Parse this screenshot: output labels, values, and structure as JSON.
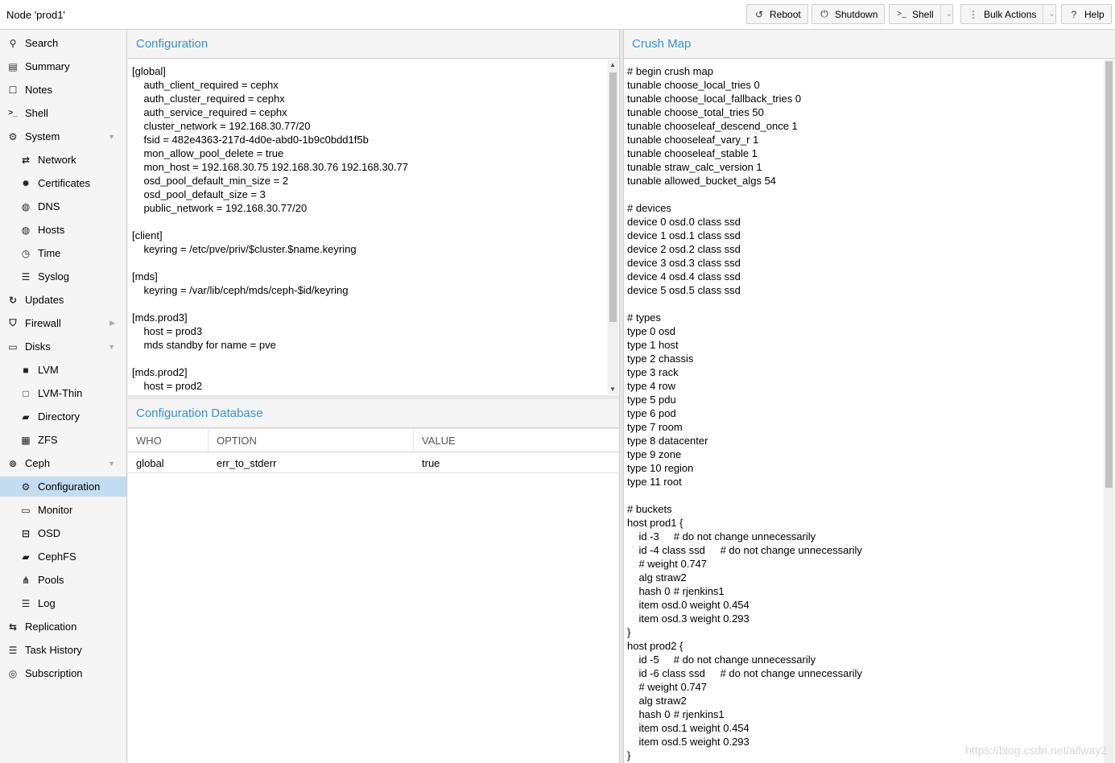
{
  "header": {
    "title": "Node 'prod1'",
    "buttons": {
      "reboot": "Reboot",
      "shutdown": "Shutdown",
      "shell": "Shell",
      "bulk_actions": "Bulk Actions",
      "help": "Help"
    }
  },
  "sidebar": {
    "items": [
      {
        "label": "Search",
        "icon": "search-icon"
      },
      {
        "label": "Summary",
        "icon": "book-icon"
      },
      {
        "label": "Notes",
        "icon": "note-icon"
      },
      {
        "label": "Shell",
        "icon": "terminal-icon"
      },
      {
        "label": "System",
        "icon": "gears-icon"
      },
      {
        "label": "Network",
        "icon": "exchange-icon"
      },
      {
        "label": "Certificates",
        "icon": "certificate-icon"
      },
      {
        "label": "DNS",
        "icon": "globe-icon"
      },
      {
        "label": "Hosts",
        "icon": "globe-icon"
      },
      {
        "label": "Time",
        "icon": "clock-icon"
      },
      {
        "label": "Syslog",
        "icon": "list-icon"
      },
      {
        "label": "Updates",
        "icon": "refresh-icon"
      },
      {
        "label": "Firewall",
        "icon": "shield-icon"
      },
      {
        "label": "Disks",
        "icon": "hdd-icon"
      },
      {
        "label": "LVM",
        "icon": "square-icon"
      },
      {
        "label": "LVM-Thin",
        "icon": "square-outline-icon"
      },
      {
        "label": "Directory",
        "icon": "folder-icon"
      },
      {
        "label": "ZFS",
        "icon": "th-large-icon"
      },
      {
        "label": "Ceph",
        "icon": "ceph-icon"
      },
      {
        "label": "Configuration",
        "icon": "gear-icon"
      },
      {
        "label": "Monitor",
        "icon": "desktop-icon"
      },
      {
        "label": "OSD",
        "icon": "hdd-icon"
      },
      {
        "label": "CephFS",
        "icon": "folder-icon"
      },
      {
        "label": "Pools",
        "icon": "sitemap-icon"
      },
      {
        "label": "Log",
        "icon": "list-icon"
      },
      {
        "label": "Replication",
        "icon": "retweet-icon"
      },
      {
        "label": "Task History",
        "icon": "list-icon"
      },
      {
        "label": "Subscription",
        "icon": "support-icon"
      }
    ]
  },
  "config_panel": {
    "title": "Configuration",
    "text": "[global]\n\tauth_client_required = cephx\n\tauth_cluster_required = cephx\n\tauth_service_required = cephx\n\tcluster_network = 192.168.30.77/20\n\tfsid = 482e4363-217d-4d0e-abd0-1b9c0bdd1f5b\n\tmon_allow_pool_delete = true\n\tmon_host = 192.168.30.75 192.168.30.76 192.168.30.77\n\tosd_pool_default_min_size = 2\n\tosd_pool_default_size = 3\n\tpublic_network = 192.168.30.77/20\n\n[client]\n\tkeyring = /etc/pve/priv/$cluster.$name.keyring\n\n[mds]\n\tkeyring = /var/lib/ceph/mds/ceph-$id/keyring\n\n[mds.prod3]\n\thost = prod3\n\tmds standby for name = pve\n\n[mds.prod2]\n\thost = prod2"
  },
  "config_db": {
    "title": "Configuration Database",
    "columns": [
      "WHO",
      "OPTION",
      "VALUE"
    ],
    "rows": [
      {
        "who": "global",
        "option": "err_to_stderr",
        "value": "true"
      }
    ]
  },
  "crush_panel": {
    "title": "Crush Map",
    "text": "# begin crush map\ntunable choose_local_tries 0\ntunable choose_local_fallback_tries 0\ntunable choose_total_tries 50\ntunable chooseleaf_descend_once 1\ntunable chooseleaf_vary_r 1\ntunable chooseleaf_stable 1\ntunable straw_calc_version 1\ntunable allowed_bucket_algs 54\n\n# devices\ndevice 0 osd.0 class ssd\ndevice 1 osd.1 class ssd\ndevice 2 osd.2 class ssd\ndevice 3 osd.3 class ssd\ndevice 4 osd.4 class ssd\ndevice 5 osd.5 class ssd\n\n# types\ntype 0 osd\ntype 1 host\ntype 2 chassis\ntype 3 rack\ntype 4 row\ntype 5 pdu\ntype 6 pod\ntype 7 room\ntype 8 datacenter\ntype 9 zone\ntype 10 region\ntype 11 root\n\n# buckets\nhost prod1 {\n\tid -3\t\t# do not change unnecessarily\n\tid -4 class ssd\t\t# do not change unnecessarily\n\t# weight 0.747\n\talg straw2\n\thash 0\t# rjenkins1\n\titem osd.0 weight 0.454\n\titem osd.3 weight 0.293\n}\nhost prod2 {\n\tid -5\t\t# do not change unnecessarily\n\tid -6 class ssd\t\t# do not change unnecessarily\n\t# weight 0.747\n\talg straw2\n\thash 0\t# rjenkins1\n\titem osd.1 weight 0.454\n\titem osd.5 weight 0.293\n}"
  },
  "watermark": "https://blog.csdn.net/allway2",
  "colors": {
    "accent": "#3892d4",
    "selected": "#c2ddf2"
  }
}
